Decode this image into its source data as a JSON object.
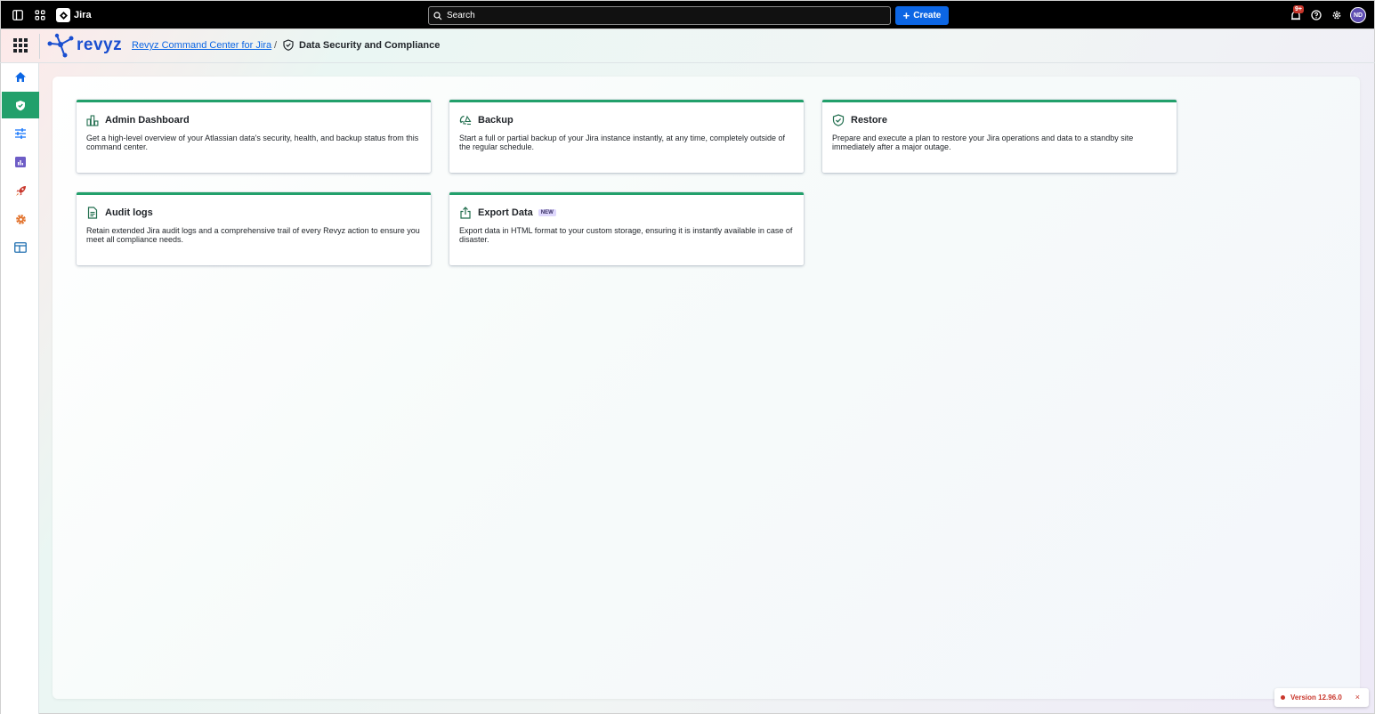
{
  "topbar": {
    "app_name": "Jira",
    "search_placeholder": "Search",
    "create_label": "Create",
    "notification_count": "9+",
    "avatar_initials": "ND"
  },
  "header": {
    "brand": "revyz",
    "breadcrumb_link": "Revyz Command Center for Jira",
    "breadcrumb_sep": "/",
    "breadcrumb_current": "Data Security and Compliance"
  },
  "cards": [
    {
      "title": "Admin Dashboard",
      "icon": "chart-icon",
      "desc": "Get a high-level overview of your Atlassian data's security, health, and backup status from this command center."
    },
    {
      "title": "Backup",
      "icon": "backup-icon",
      "desc": "Start a full or partial backup of your Jira instance instantly, at any time, completely outside of the regular schedule."
    },
    {
      "title": "Restore",
      "icon": "shield-check-icon",
      "desc": "Prepare and execute a plan to restore your Jira operations and data to a standby site immediately after a major outage."
    },
    {
      "title": "Audit logs",
      "icon": "document-icon",
      "desc": "Retain extended Jira audit logs and a comprehensive trail of every Revyz action to ensure you meet all compliance needs."
    },
    {
      "title": "Export Data",
      "icon": "export-icon",
      "badge": "NEW",
      "desc": "Export data in HTML format to your custom storage, ensuring it is instantly available in case of disaster."
    }
  ],
  "version": {
    "label": "Version 12.96.0",
    "close": "×"
  },
  "colors": {
    "accent_green": "#22a06b",
    "brand_blue": "#1a4fd0",
    "create_blue": "#0c66e4",
    "version_red": "#c9372c"
  }
}
